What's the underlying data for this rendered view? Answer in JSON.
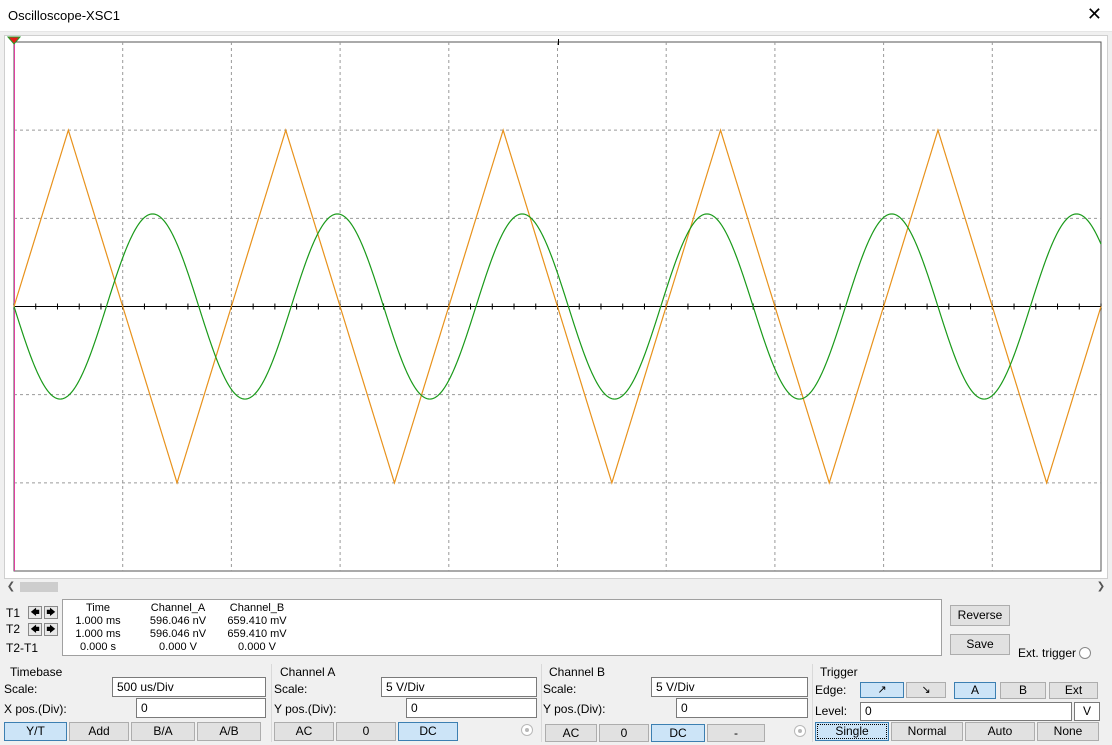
{
  "window": {
    "title": "Oscilloscope-XSC1",
    "close_glyph": "✕"
  },
  "colors": {
    "channel_a": "#e8921c",
    "channel_b": "#1a9a1a",
    "grid": "#9a9a9a",
    "trigger_marker": "#e61b1b",
    "cursor_t1": "#e040a0"
  },
  "cursors": {
    "t1_label": "T1",
    "t2_label": "T2",
    "diff_label": "T2-T1",
    "left_arrow": "🡄",
    "right_arrow": "🡆"
  },
  "measurements": {
    "headers": [
      "Time",
      "Channel_A",
      "Channel_B"
    ],
    "rows": [
      [
        "1.000 ms",
        "596.046 nV",
        "659.410 mV"
      ],
      [
        "1.000 ms",
        "596.046 nV",
        "659.410 mV"
      ],
      [
        "0.000 s",
        "0.000 V",
        "0.000 V"
      ]
    ]
  },
  "actions": {
    "reverse": "Reverse",
    "save": "Save",
    "ext_trigger": "Ext. trigger"
  },
  "timebase": {
    "title": "Timebase",
    "scale_label": "Scale:",
    "scale_value": "500 us/Div",
    "xpos_label": "X pos.(Div):",
    "xpos_value": "0",
    "modes": [
      "Y/T",
      "Add",
      "B/A",
      "A/B"
    ]
  },
  "channel_a": {
    "title": "Channel A",
    "scale_label": "Scale:",
    "scale_value": "5  V/Div",
    "ypos_label": "Y pos.(Div):",
    "ypos_value": "0",
    "coupling": [
      "AC",
      "0",
      "DC"
    ]
  },
  "channel_b": {
    "title": "Channel B",
    "scale_label": "Scale:",
    "scale_value": "5  V/Div",
    "ypos_label": "Y pos.(Div):",
    "ypos_value": "0",
    "coupling": [
      "AC",
      "0",
      "DC",
      "-"
    ]
  },
  "trigger": {
    "title": "Trigger",
    "edge_label": "Edge:",
    "edge_rising_glyph": "↗",
    "edge_falling_glyph": "↘",
    "sources": [
      "A",
      "B",
      "Ext"
    ],
    "level_label": "Level:",
    "level_value": "0",
    "level_unit": "V",
    "modes": [
      "Single",
      "Normal",
      "Auto",
      "None"
    ]
  },
  "chart_data": {
    "type": "line",
    "divisions_x": 10,
    "divisions_y": 6,
    "y_range_div": [
      -3,
      3
    ],
    "x_range_div": [
      0,
      10
    ],
    "series": [
      {
        "color": "#e8921c",
        "shape": "triangle",
        "period_div": 2.0,
        "amplitude_div": 2.0,
        "phase": "rising_from_zero_at_x0"
      },
      {
        "color": "#1a9a1a",
        "shape": "sine",
        "period_div": 1.7,
        "amplitude_div": 1.05,
        "phase": "falling_from_zero_at_x0"
      }
    ]
  }
}
